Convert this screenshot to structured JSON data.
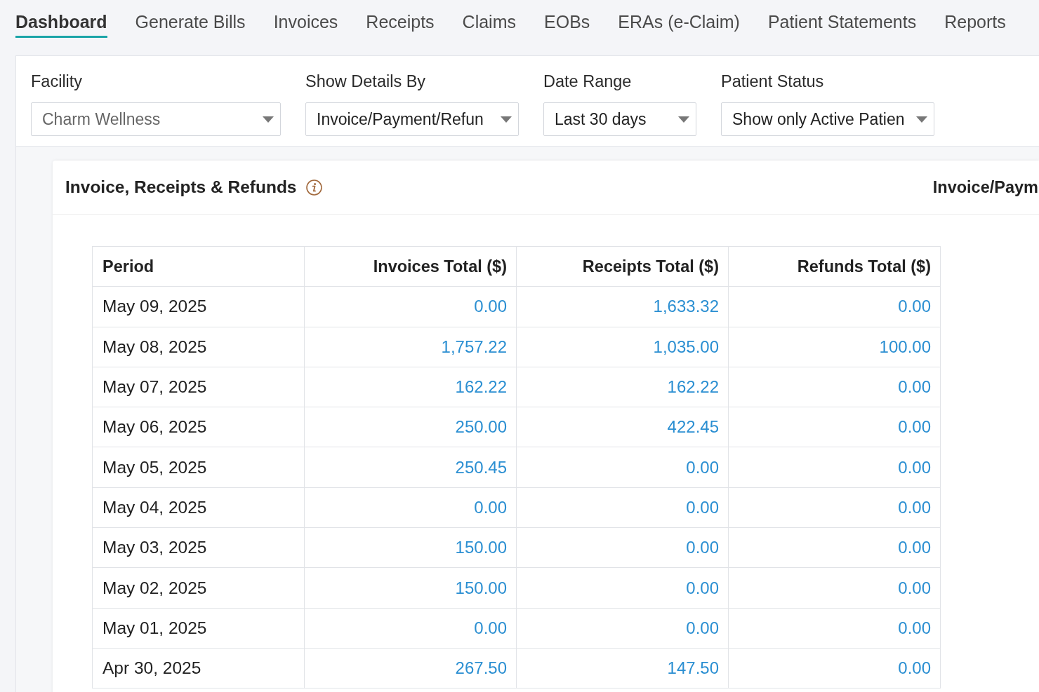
{
  "tabs": [
    {
      "label": "Dashboard",
      "selected": true
    },
    {
      "label": "Generate Bills",
      "selected": false
    },
    {
      "label": "Invoices",
      "selected": false
    },
    {
      "label": "Receipts",
      "selected": false
    },
    {
      "label": "Claims",
      "selected": false
    },
    {
      "label": "EOBs",
      "selected": false
    },
    {
      "label": "ERAs (e-Claim)",
      "selected": false
    },
    {
      "label": "Patient Statements",
      "selected": false
    },
    {
      "label": "Reports",
      "selected": false
    }
  ],
  "filters": [
    {
      "label": "Facility",
      "value": "Charm Wellness",
      "disabled": true
    },
    {
      "label": "Show Details By",
      "value": "Invoice/Payment/Refun",
      "disabled": false
    },
    {
      "label": "Date Range",
      "value": "Last 30 days",
      "disabled": false
    },
    {
      "label": "Patient Status",
      "value": "Show only Active Patien",
      "disabled": false
    }
  ],
  "panel": {
    "title": "Invoice, Receipts & Refunds",
    "right_label": "Invoice/Paym",
    "table": {
      "columns": [
        {
          "label": "Period",
          "kind": "text"
        },
        {
          "label": "Invoices Total ($)",
          "kind": "amount"
        },
        {
          "label": "Receipts Total ($)",
          "kind": "amount"
        },
        {
          "label": "Refunds Total ($)",
          "kind": "amount"
        }
      ],
      "rows": [
        [
          "May 09, 2025",
          "0.00",
          "1,633.32",
          "0.00"
        ],
        [
          "May 08, 2025",
          "1,757.22",
          "1,035.00",
          "100.00"
        ],
        [
          "May 07, 2025",
          "162.22",
          "162.22",
          "0.00"
        ],
        [
          "May 06, 2025",
          "250.00",
          "422.45",
          "0.00"
        ],
        [
          "May 05, 2025",
          "250.45",
          "0.00",
          "0.00"
        ],
        [
          "May 04, 2025",
          "0.00",
          "0.00",
          "0.00"
        ],
        [
          "May 03, 2025",
          "150.00",
          "0.00",
          "0.00"
        ],
        [
          "May 02, 2025",
          "150.00",
          "0.00",
          "0.00"
        ],
        [
          "May 01, 2025",
          "0.00",
          "0.00",
          "0.00"
        ],
        [
          "Apr 30, 2025",
          "267.50",
          "147.50",
          "0.00"
        ]
      ]
    }
  }
}
